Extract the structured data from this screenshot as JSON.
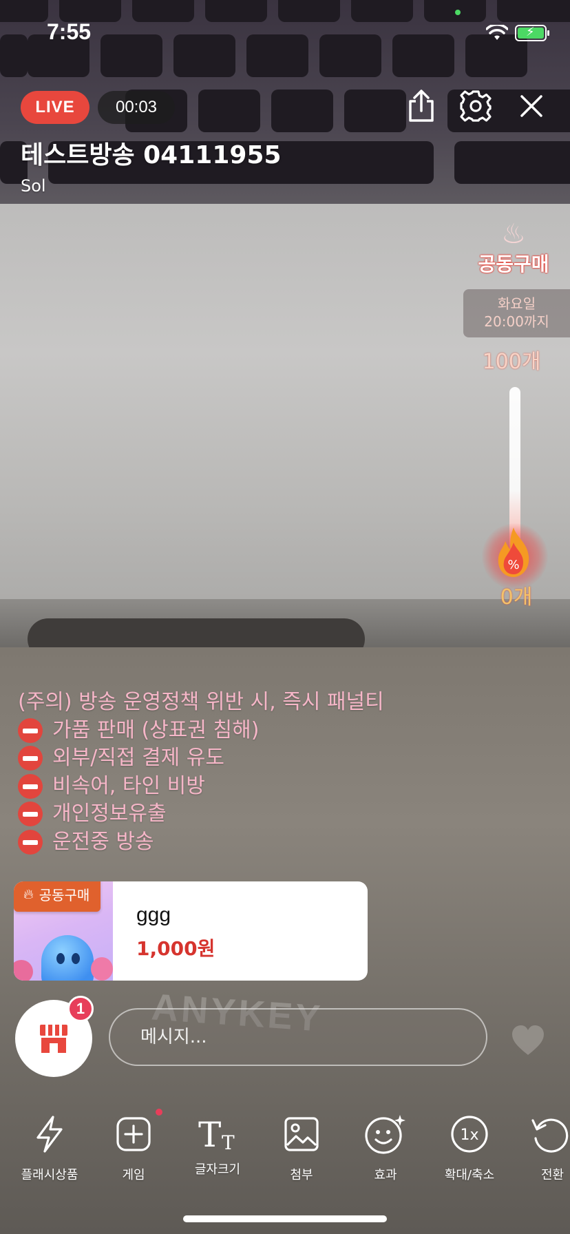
{
  "status_bar": {
    "time": "7:55"
  },
  "header": {
    "live_label": "LIVE",
    "elapsed": "00:03",
    "title": "테스트방송 04111955",
    "host": "Sol"
  },
  "group_buy": {
    "logo_text": "공동구매",
    "deadline_day": "화요일",
    "deadline_time": "20:00까지",
    "max_label": "100개",
    "current_label": "0개",
    "progress": 0
  },
  "notice": {
    "heading": "(주의) 방송 운영정책 위반 시, 즉시 패널티",
    "items": [
      "가품 판매 (상표권 침해)",
      "외부/직접 결제 유도",
      "비속어, 타인 비방",
      "개인정보유출",
      "운전중 방송"
    ]
  },
  "product": {
    "tag": "공동구매",
    "name": "ggg",
    "price": "1,000원"
  },
  "chat": {
    "badge_count": "1",
    "placeholder": "메시지..."
  },
  "tools": [
    {
      "label": "플래시상품",
      "icon": "lightning-icon"
    },
    {
      "label": "게임",
      "icon": "plus-square-icon"
    },
    {
      "label": "글자크기",
      "icon": "text-size-icon"
    },
    {
      "label": "첨부",
      "icon": "image-icon"
    },
    {
      "label": "효과",
      "icon": "sparkle-face-icon"
    },
    {
      "label": "확대/축소",
      "icon": "zoom-1x-icon"
    },
    {
      "label": "전환",
      "icon": "rotate-icon"
    }
  ],
  "colors": {
    "live": "#e8473d",
    "notice_text": "#f6b6c8",
    "price": "#d6342e",
    "tag": "#e0612d",
    "badge": "#e73e5a"
  },
  "background_text": "ANYKEY"
}
